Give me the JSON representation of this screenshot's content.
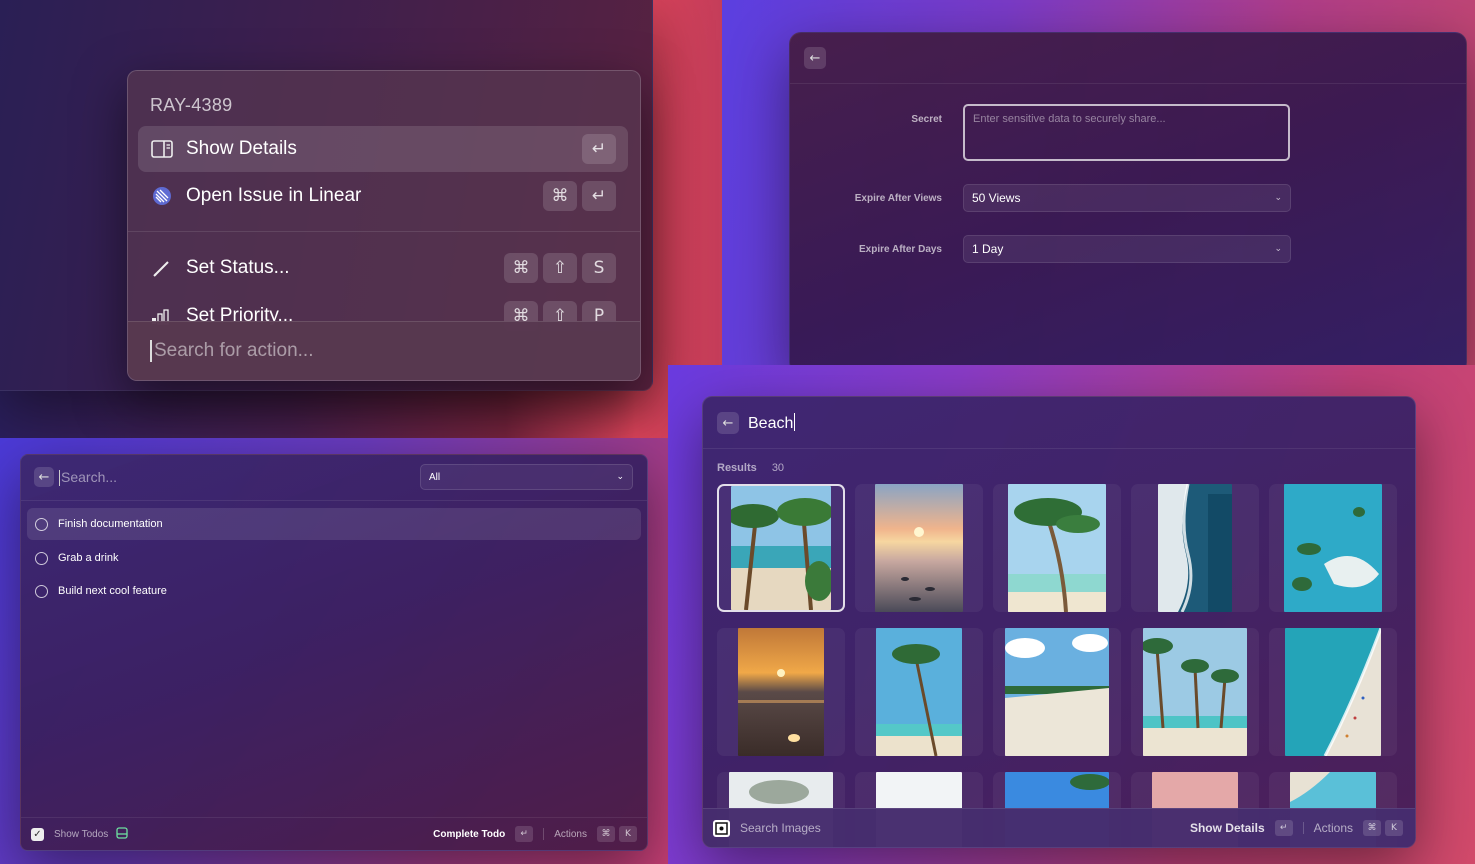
{
  "actions_panel": {
    "title": "RAY-4389",
    "items": [
      {
        "label": "Show Details",
        "icon": "sidebar-panel-icon",
        "keys": [
          "↵"
        ],
        "selected": true
      },
      {
        "label": "Open Issue in Linear",
        "icon": "linear-logo-icon",
        "keys": [
          "⌘",
          "↵"
        ]
      },
      {
        "label": "Set Status...",
        "icon": "pencil-icon",
        "keys": [
          "⌘",
          "⇧",
          "S"
        ]
      },
      {
        "label": "Set Priority...",
        "icon": "priority-bars-icon",
        "keys": [
          "⌘",
          "⇧",
          "P"
        ]
      }
    ],
    "search_placeholder": "Search for action..."
  },
  "secret_form": {
    "back_icon": "←",
    "fields": {
      "secret": {
        "label": "Secret",
        "placeholder": "Enter sensitive data to securely share..."
      },
      "views": {
        "label": "Expire After Views",
        "value": "50 Views"
      },
      "days": {
        "label": "Expire After Days",
        "value": "1 Day"
      }
    },
    "chevron": "⌄"
  },
  "todos": {
    "back_icon": "←",
    "search_placeholder": "Search...",
    "filter": {
      "value": "All",
      "chevron": "⌄"
    },
    "items": [
      {
        "label": "Finish documentation",
        "selected": true
      },
      {
        "label": "Grab a drink"
      },
      {
        "label": "Build next cool feature"
      }
    ],
    "footer": {
      "app_label": "Show Todos",
      "primary_action": "Complete Todo",
      "enter_key": "↵",
      "actions_label": "Actions",
      "cmd_key": "⌘",
      "k_key": "K"
    }
  },
  "images": {
    "back_icon": "←",
    "query": "Beach",
    "results_label": "Results",
    "results_count": "30",
    "footer": {
      "app_label": "Search Images",
      "primary_action": "Show Details",
      "enter_key": "↵",
      "actions_label": "Actions",
      "cmd_key": "⌘",
      "k_key": "K"
    },
    "thumbnails": [
      {
        "name": "palm-beach-portrait"
      },
      {
        "name": "sunset-sea-portrait"
      },
      {
        "name": "palm-tree-portrait"
      },
      {
        "name": "aerial-coast-portrait"
      },
      {
        "name": "aerial-island-portrait"
      },
      {
        "name": "golden-sunset-portrait"
      },
      {
        "name": "single-palm-portrait"
      },
      {
        "name": "white-beach-landscape"
      },
      {
        "name": "palms-beach-landscape"
      },
      {
        "name": "aerial-shore-portrait"
      }
    ]
  }
}
